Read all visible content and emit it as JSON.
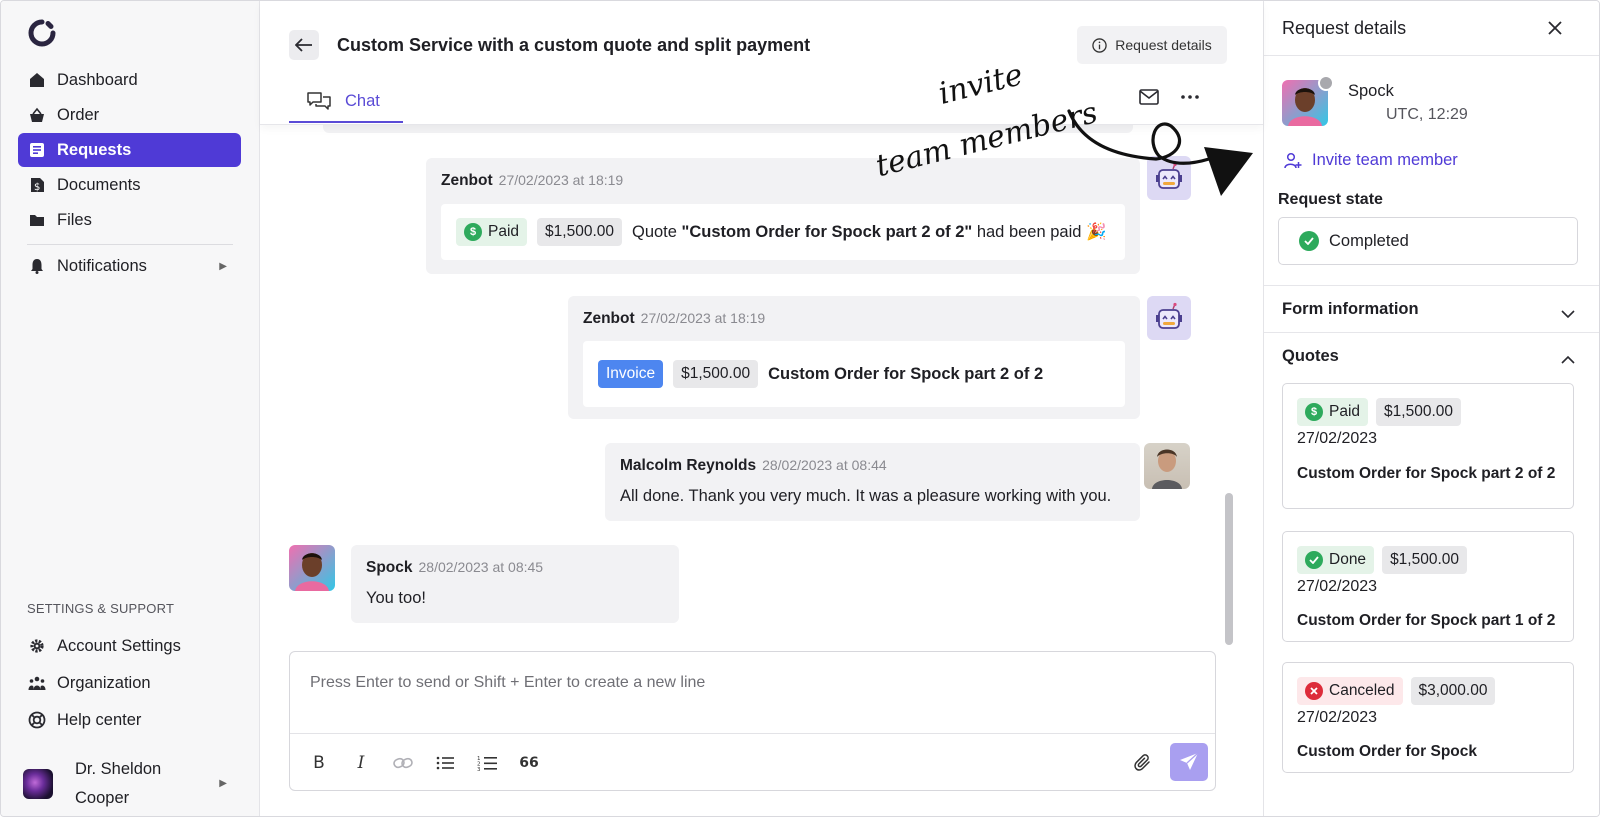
{
  "sidebar": {
    "nav": [
      {
        "label": "Dashboard",
        "icon": "home-icon"
      },
      {
        "label": "Order",
        "icon": "basket-icon"
      },
      {
        "label": "Requests",
        "icon": "requests-icon",
        "active": true
      },
      {
        "label": "Documents",
        "icon": "document-dollar-icon"
      },
      {
        "label": "Files",
        "icon": "folder-icon"
      },
      {
        "label": "Notifications",
        "icon": "bell-icon"
      }
    ],
    "section_label": "SETTINGS & SUPPORT",
    "support": [
      {
        "label": "Account Settings",
        "icon": "gear-icon"
      },
      {
        "label": "Organization",
        "icon": "people-icon"
      },
      {
        "label": "Help center",
        "icon": "lifebuoy-icon"
      }
    ],
    "user": {
      "name": "Dr. Sheldon Cooper"
    }
  },
  "header": {
    "title": "Custom Service with a custom quote and split payment",
    "request_details_label": "Request details",
    "tab_chat": "Chat"
  },
  "messages": [
    {
      "author": "Zenbot",
      "timestamp": "27/02/2023 at 18:19",
      "status": "Paid",
      "amount": "$1,500.00",
      "text_prefix": "Quote ",
      "text_bold": "\"Custom Order for Spock part 2 of 2\"",
      "text_suffix": " had been paid 🎉"
    },
    {
      "author": "Zenbot",
      "timestamp": "27/02/2023 at 18:19",
      "status": "Invoice",
      "amount": "$1,500.00",
      "text_bold": "Custom Order for Spock part 2 of 2"
    },
    {
      "author": "Malcolm Reynolds",
      "timestamp": "28/02/2023 at 08:44",
      "text": "All done. Thank you very much. It was a pleasure working with you."
    },
    {
      "author": "Spock",
      "timestamp": "28/02/2023 at 08:45",
      "text": "You too!"
    }
  ],
  "composer": {
    "placeholder": "Press Enter to send or Shift + Enter to create a new line",
    "quote_label": "66"
  },
  "panel": {
    "title": "Request details",
    "client": {
      "name": "Spock",
      "timezone": "UTC, 12:29"
    },
    "invite_label": "Invite team member",
    "state_label": "Request state",
    "state_value": "Completed",
    "form_info_label": "Form information",
    "quotes_label": "Quotes",
    "quotes": [
      {
        "status": "Paid",
        "amount": "$1,500.00",
        "date": "27/02/2023",
        "title": "Custom Order for Spock part 2 of 2"
      },
      {
        "status": "Done",
        "amount": "$1,500.00",
        "date": "27/02/2023",
        "title": "Custom Order for Spock part 1 of 2"
      },
      {
        "status": "Canceled",
        "amount": "$3,000.00",
        "date": "27/02/2023",
        "title": "Custom Order for Spock"
      }
    ]
  },
  "annotation": {
    "line1": "invite",
    "line2": "team members"
  },
  "colors": {
    "accent": "#4f3ad6",
    "paid_green": "#2daa5c",
    "invoice_blue": "#4d86f0",
    "canceled_red": "#dd2b3a",
    "bubble_bg": "#f2f2f4"
  }
}
